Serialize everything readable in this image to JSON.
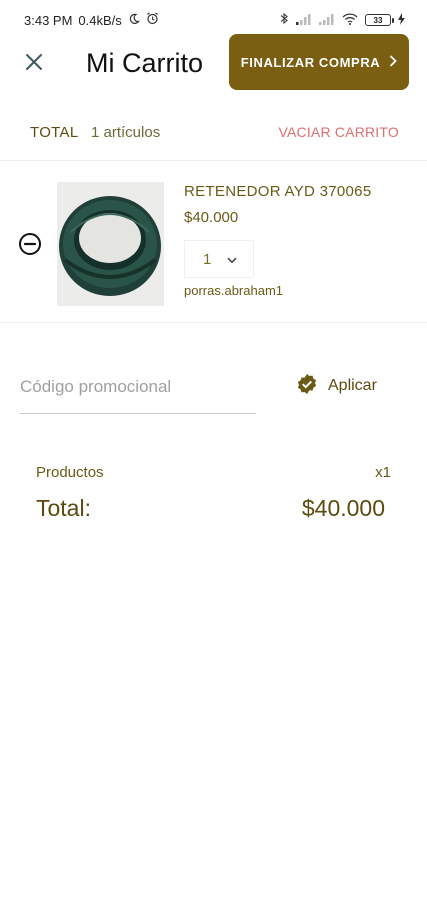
{
  "status_bar": {
    "time": "3:43 PM",
    "speed": "0.4kB/s",
    "battery": "33",
    "icons": [
      "moon-icon",
      "alarm-icon",
      "bluetooth-icon",
      "signal-icon",
      "signal-icon",
      "wifi-icon",
      "battery-icon",
      "charging-icon"
    ]
  },
  "header": {
    "title": "Mi Carrito",
    "checkout_label": "FINALIZAR COMPRA",
    "close_icon": "close-icon",
    "checkout_icon": "chevron-right-icon"
  },
  "summary": {
    "total_label": "TOTAL",
    "items_count": "1 artículos",
    "clear_label": "VACIAR CARRITO"
  },
  "cart": {
    "items": [
      {
        "name": "RETENEDOR AYD 370065",
        "price": "$40.000",
        "quantity": "1",
        "seller": "porras.abraham1",
        "remove_icon": "minus-circle-icon"
      }
    ]
  },
  "promo": {
    "placeholder": "Código promocional",
    "value": "",
    "apply_label": "Aplicar",
    "apply_icon": "verified-check-icon"
  },
  "totals": {
    "products_label": "Productos",
    "products_count": "x1",
    "total_label": "Total:",
    "total_value": "$40.000"
  },
  "colors": {
    "accent": "#7a5e12",
    "text_gold": "#6b5a17",
    "danger": "#e06d70"
  }
}
